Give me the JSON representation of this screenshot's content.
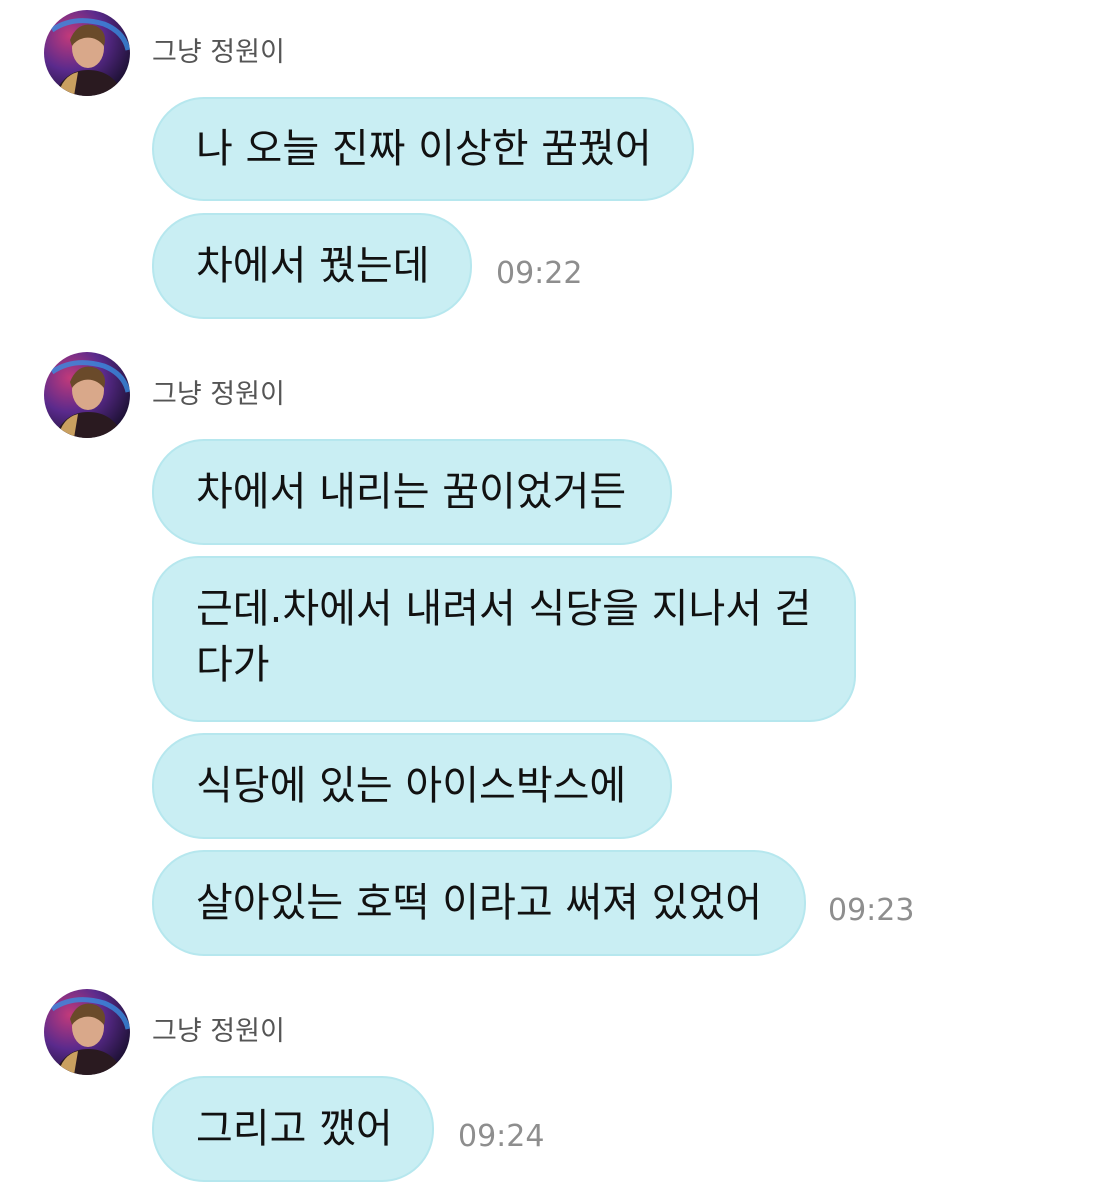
{
  "chat": {
    "groups": [
      {
        "sender": "그냥 정원이",
        "avatar_icon": "profile-avatar",
        "messages": [
          {
            "text": "나 오늘 진짜 이상한 꿈꿨어"
          },
          {
            "text": "차에서 꿨는데"
          }
        ],
        "time": "09:22"
      },
      {
        "sender": "그냥 정원이",
        "avatar_icon": "profile-avatar",
        "messages": [
          {
            "text": "차에서 내리는 꿈이었거든"
          },
          {
            "text": "근데.차에서 내려서 식당을 지나서 걷다가"
          },
          {
            "text": "식당에 있는 아이스박스에"
          },
          {
            "text": "살아있는 호떡 이라고 써져 있었어"
          }
        ],
        "time": "09:23"
      },
      {
        "sender": "그냥 정원이",
        "avatar_icon": "profile-avatar",
        "messages": [
          {
            "text": "그리고 깼어"
          }
        ],
        "time": "09:24"
      }
    ]
  },
  "colors": {
    "bubble_bg": "#c9eef3",
    "bubble_border": "#b6e7ee",
    "time_text": "#8e8e8e",
    "sender_text": "#555555"
  }
}
